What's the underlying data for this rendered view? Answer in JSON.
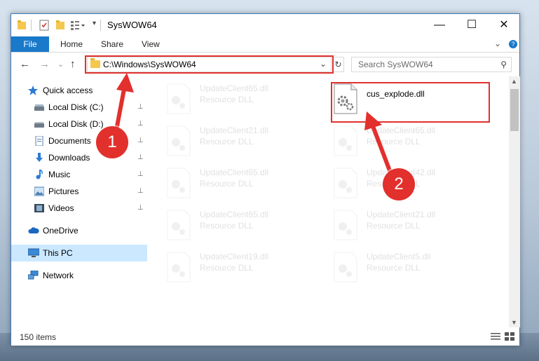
{
  "window": {
    "title": "SysWOW64",
    "buttons": {
      "minimize": "—",
      "maximize": "☐",
      "close": "✕"
    }
  },
  "ribbon": {
    "tabs": [
      "File",
      "Home",
      "Share",
      "View"
    ],
    "collapse_glyph": "⌄",
    "help_glyph": "?"
  },
  "address": {
    "path": "C:\\Windows\\SysWOW64",
    "dropdown_glyph": "⌄",
    "refresh_glyph": "↻"
  },
  "search": {
    "placeholder": "Search SysWOW64",
    "icon_glyph": "⚲"
  },
  "nav": {
    "back": "←",
    "forward": "→",
    "recent": "⌄",
    "up": "↑",
    "pin_glyph": "📌",
    "items": [
      {
        "label": "Quick access",
        "icon": "star-icon",
        "pinned": false
      },
      {
        "label": "Local Disk (C:)",
        "icon": "drive-icon",
        "pinned": true
      },
      {
        "label": "Local Disk (D:)",
        "icon": "drive-icon",
        "pinned": true
      },
      {
        "label": "Documents",
        "icon": "documents-icon",
        "pinned": true
      },
      {
        "label": "Downloads",
        "icon": "download-icon",
        "pinned": true
      },
      {
        "label": "Music",
        "icon": "music-icon",
        "pinned": true
      },
      {
        "label": "Pictures",
        "icon": "pictures-icon",
        "pinned": true
      },
      {
        "label": "Videos",
        "icon": "videos-icon",
        "pinned": true
      },
      {
        "label": "OneDrive",
        "icon": "cloud-icon",
        "pinned": false
      },
      {
        "label": "This PC",
        "icon": "computer-icon",
        "pinned": false,
        "selected": true
      },
      {
        "label": "Network",
        "icon": "network-icon",
        "pinned": false
      }
    ]
  },
  "files": {
    "type_label": "Resource DLL",
    "left_column": [
      "UpdateClient65.dll",
      "UpdateClient21.dll",
      "UpdateClient65.dll",
      "UpdateClient65.dll",
      "UpdateClient19.dll"
    ],
    "right_column": [
      "cus_explode.dll",
      "UpdateClient65.dll",
      "UpdateClient42.dll",
      "UpdateClient21.dll",
      "UpdateClient5.dll"
    ]
  },
  "status": {
    "item_count": "150 items"
  },
  "annotations": {
    "step1": "1",
    "step2": "2",
    "color": "#e2302d"
  }
}
